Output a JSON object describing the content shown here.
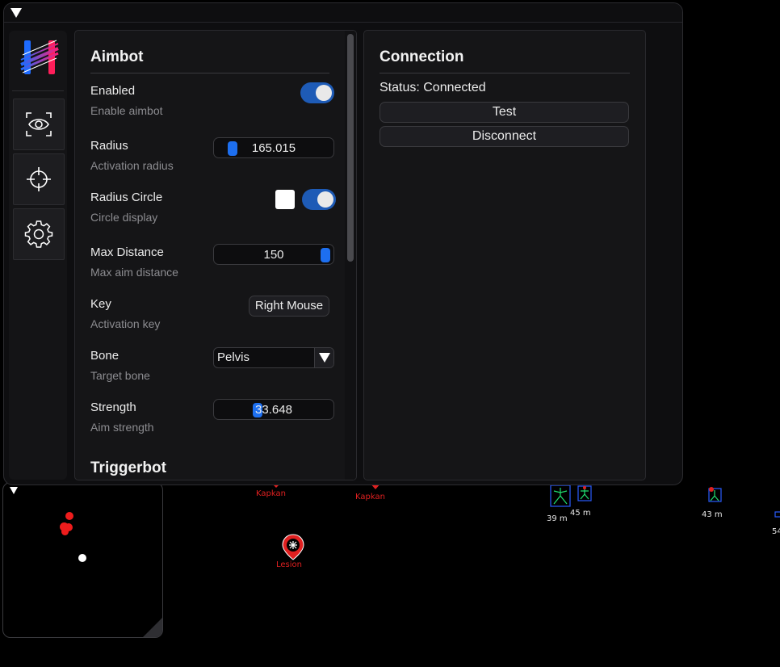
{
  "sidebar": {
    "items": [
      {
        "name": "visuals",
        "icon": "eye-icon"
      },
      {
        "name": "aimbot",
        "icon": "crosshair-icon"
      },
      {
        "name": "settings",
        "icon": "gear-icon"
      }
    ]
  },
  "aimbot": {
    "title": "Aimbot",
    "enabled": {
      "label": "Enabled",
      "desc": "Enable aimbot",
      "on": true
    },
    "radius": {
      "label": "Radius",
      "desc": "Activation radius",
      "value": "165.015",
      "fraction": 0.1
    },
    "radius_circle": {
      "label": "Radius Circle",
      "desc": "Circle display",
      "on": true,
      "color": "#ffffff"
    },
    "max_distance": {
      "label": "Max Distance",
      "desc": "Max aim distance",
      "value": "150",
      "fraction": 1.0
    },
    "key": {
      "label": "Key",
      "desc": "Activation key",
      "value": "Right Mouse"
    },
    "bone": {
      "label": "Bone",
      "desc": "Target bone",
      "value": "Pelvis"
    },
    "strength": {
      "label": "Strength",
      "desc": "Aim strength",
      "value": "33.648",
      "fraction": 0.34
    }
  },
  "triggerbot": {
    "title": "Triggerbot"
  },
  "connection": {
    "title": "Connection",
    "status": "Status: Connected",
    "test_label": "Test",
    "disconnect_label": "Disconnect"
  },
  "overlay": {
    "labels": [
      {
        "text": "Kapkan"
      },
      {
        "text": "Kapkan"
      },
      {
        "text": "Lesion"
      },
      {
        "text": "39 m"
      },
      {
        "text": "45 m"
      },
      {
        "text": "43 m"
      },
      {
        "text": "54"
      }
    ]
  },
  "colors": {
    "accent": "#1d6ff0",
    "toggle_on": "#1e5bb6",
    "enemy": "#e02020"
  }
}
